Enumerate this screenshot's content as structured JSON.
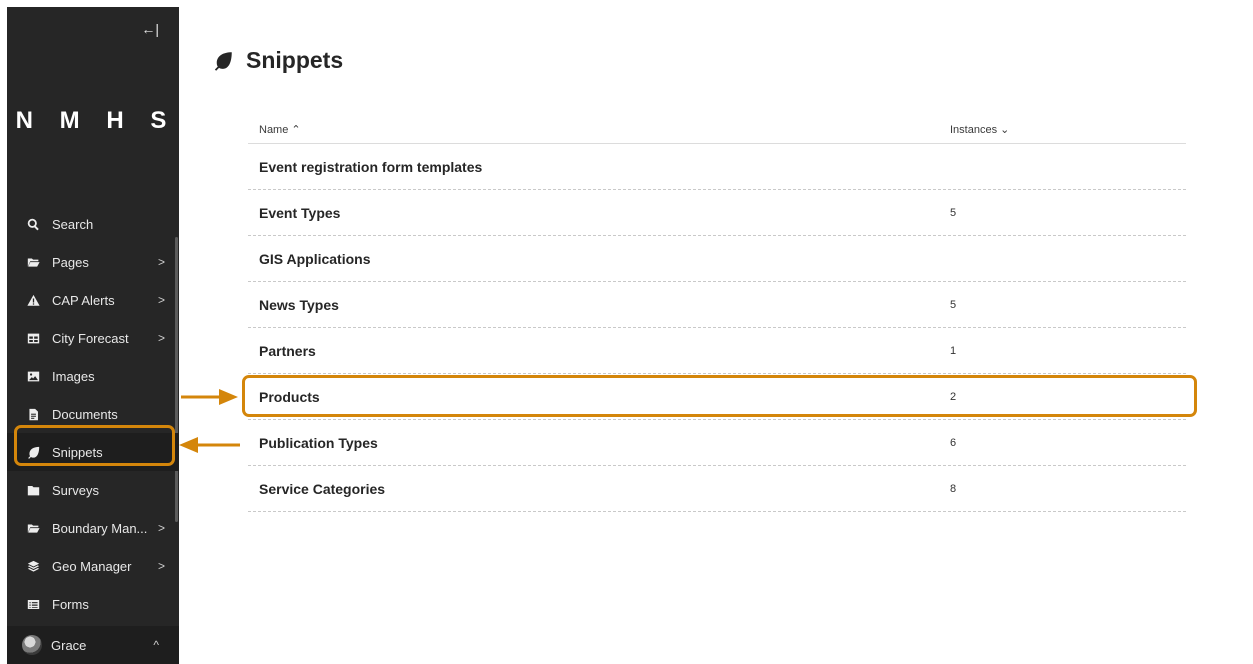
{
  "sidebar": {
    "collapse_icon": "←|",
    "logo": "N M H S",
    "items": [
      {
        "label": "Search",
        "icon": "search-icon",
        "chevron": ""
      },
      {
        "label": "Pages",
        "icon": "folder-open-icon",
        "chevron": ">"
      },
      {
        "label": "CAP Alerts",
        "icon": "warning-icon",
        "chevron": ">"
      },
      {
        "label": "City Forecast",
        "icon": "table-icon",
        "chevron": ">"
      },
      {
        "label": "Images",
        "icon": "image-icon",
        "chevron": ""
      },
      {
        "label": "Documents",
        "icon": "document-icon",
        "chevron": ""
      },
      {
        "label": "Snippets",
        "icon": "leaf-icon",
        "chevron": ""
      },
      {
        "label": "Surveys",
        "icon": "folder-icon",
        "chevron": ""
      },
      {
        "label": "Boundary Man...",
        "icon": "folder-open-icon",
        "chevron": ">"
      },
      {
        "label": "Geo Manager",
        "icon": "layers-icon",
        "chevron": ">"
      },
      {
        "label": "Forms",
        "icon": "list-icon",
        "chevron": ""
      }
    ],
    "user": {
      "name": "Grace",
      "chevron": "^"
    }
  },
  "main": {
    "title": "Snippets",
    "title_icon": "leaf-icon",
    "table": {
      "headers": {
        "name": "Name ⌃",
        "instances": "Instances ⌄"
      },
      "rows": [
        {
          "name": "Event registration form templates",
          "instances": ""
        },
        {
          "name": "Event Types",
          "instances": "5"
        },
        {
          "name": "GIS Applications",
          "instances": ""
        },
        {
          "name": "News Types",
          "instances": "5"
        },
        {
          "name": "Partners",
          "instances": "1"
        },
        {
          "name": "Products",
          "instances": "2"
        },
        {
          "name": "Publication Types",
          "instances": "6"
        },
        {
          "name": "Service Categories",
          "instances": "8"
        }
      ]
    }
  },
  "annotation": {
    "color": "#d4860b"
  }
}
